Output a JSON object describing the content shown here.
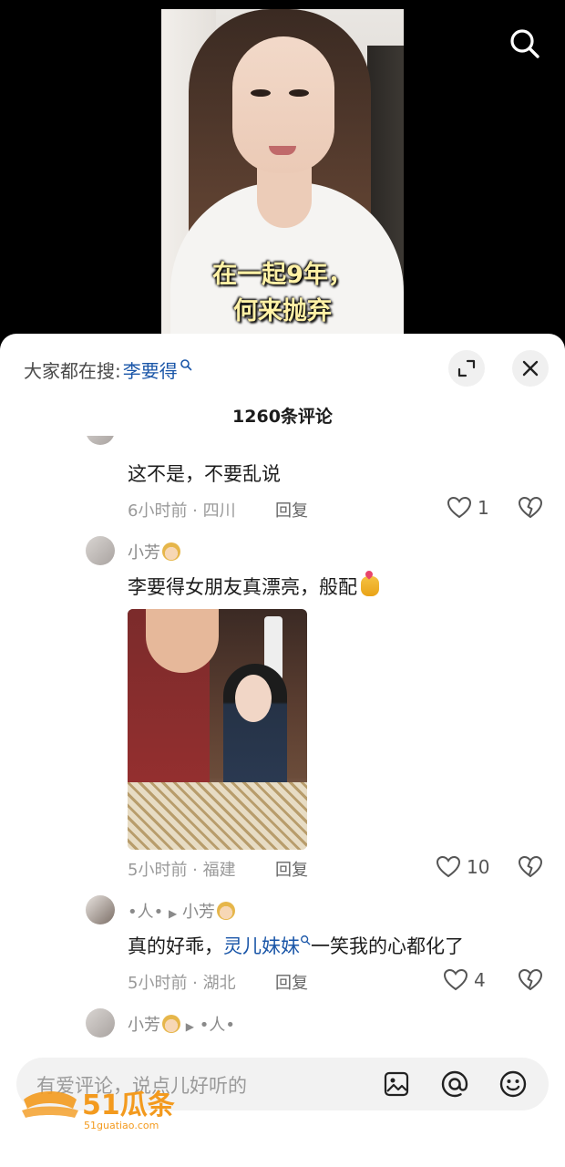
{
  "video": {
    "subtitle": "在一起9年，何来抛弃"
  },
  "sheet": {
    "search_prefix": "大家都在搜:",
    "search_term": "李要得",
    "comment_count": "1260条评论"
  },
  "comments": [
    {
      "text": "这不是，不要乱说",
      "time_location": "6小时前 · 四川",
      "reply_label": "回复",
      "likes": "1"
    },
    {
      "username": "小芳",
      "text": "李要得女朋友真漂亮，般配",
      "time_location": "5小时前 · 福建",
      "reply_label": "回复",
      "likes": "10"
    },
    {
      "username_from": "•人•",
      "username_to": "小芳",
      "text_before": "真的好乖，",
      "text_link": "灵儿妹妹",
      "text_after": "一笑我的心都化了",
      "time_location": "5小时前 · 湖北",
      "reply_label": "回复",
      "likes": "4"
    },
    {
      "username_from": "小芳",
      "username_to": "•人•"
    }
  ],
  "input": {
    "placeholder": "有爱评论，说点儿好听的"
  },
  "watermark": {
    "brand": "51瓜条",
    "url": "51guatiao.com"
  },
  "icons": {
    "top_right": "search-icon",
    "expand": "expand-icon",
    "close": "close-icon",
    "like": "heart-outline-icon",
    "dislike": "broken-heart-icon",
    "image": "image-icon",
    "mention": "at-icon",
    "emoji": "emoji-icon"
  }
}
